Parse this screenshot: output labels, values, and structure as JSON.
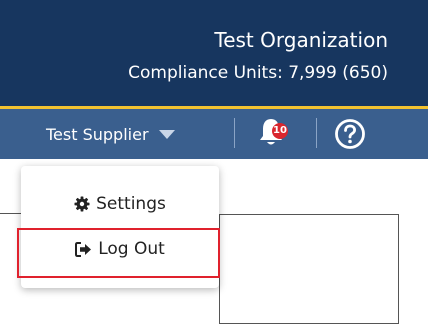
{
  "header": {
    "organization": "Test Organization",
    "compliance_units": "Compliance Units: 7,999 (650)"
  },
  "nav": {
    "user_name": "Test Supplier",
    "notification_count": "10",
    "help_icon": "question-circle-icon",
    "bell_icon": "bell-icon",
    "caret_icon": "caret-down-icon"
  },
  "dropdown": {
    "items": [
      {
        "label": "Settings",
        "icon": "gear-icon"
      },
      {
        "label": "Log Out",
        "icon": "sign-out-icon"
      }
    ]
  },
  "colors": {
    "header_dark": "#17365f",
    "header_nav": "#3a5f8e",
    "accent_gold": "#f2c230",
    "badge_red": "#d9262e",
    "highlight_red": "#e0212d"
  }
}
